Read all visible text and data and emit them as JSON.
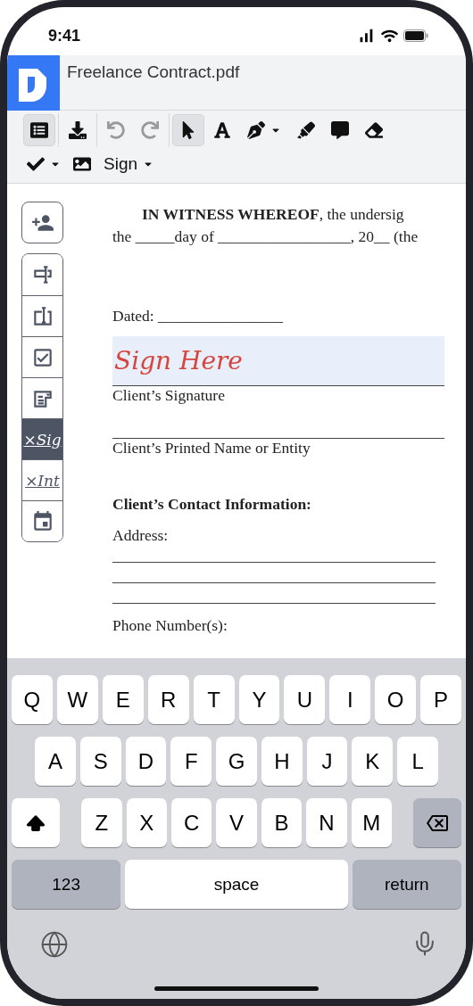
{
  "status_bar": {
    "time": "9:41"
  },
  "header": {
    "title": "Freelance Contract.pdf"
  },
  "toolbar": {
    "row_1": [
      [
        {
          "selected": true,
          "disabled": false,
          "has_menu": false
        }
      ],
      [
        {
          "selected": false,
          "disabled": false,
          "has_menu": false
        }
      ],
      [
        {
          "selected": false,
          "disabled": true,
          "has_menu": false
        },
        {
          "selected": false,
          "disabled": true,
          "has_menu": false
        }
      ],
      [
        {
          "selected": true,
          "disabled": false,
          "has_menu": false
        },
        {
          "selected": false,
          "disabled": false,
          "has_menu": false
        },
        {
          "selected": false,
          "disabled": false,
          "has_menu": true
        },
        {
          "selected": false,
          "disabled": false,
          "has_menu": false
        },
        {
          "selected": false,
          "disabled": false,
          "has_menu": false
        },
        {
          "selected": false,
          "disabled": false,
          "has_menu": false
        }
      ]
    ],
    "row_2": [
      {
        "selected": false,
        "has_menu": true
      },
      {
        "selected": false,
        "has_menu": false
      },
      {
        "selected": false,
        "has_menu": true,
        "label": "Sign"
      }
    ]
  },
  "sidebar": {
    "tools": [
      {
        "selected": false
      },
      {
        "selected": false
      },
      {
        "selected": false
      },
      {
        "selected": false
      },
      {
        "selected": true,
        "label": "×Sig"
      },
      {
        "selected": false,
        "label": "×Int"
      },
      {
        "selected": false
      }
    ]
  },
  "document": [
    {
      "kind": "paragraph",
      "lines": [
        "**IN WITNESS WHEREOF**, the undersig",
        "the _____day of _________________, 20__ (the"
      ]
    },
    {
      "kind": "text",
      "text": "Dated: ________________"
    },
    {
      "kind": "signature",
      "placeholder": "Sign Here",
      "label": "Client’s Signature"
    },
    {
      "kind": "line",
      "label": "Client’s Printed Name or Entity"
    },
    {
      "kind": "heading",
      "text": "Client’s Contact Information:"
    },
    {
      "kind": "lines",
      "label": "Address:"
    },
    {
      "kind": "text",
      "text": "Phone Number(s):"
    }
  ],
  "keyboard": {
    "rows": [
      [
        "Q",
        "W",
        "E",
        "R",
        "T",
        "Y",
        "U",
        "I",
        "O",
        "P"
      ],
      [
        "A",
        "S",
        "D",
        "F",
        "G",
        "H",
        "J",
        "K",
        "L"
      ],
      [
        "Z",
        "X",
        "C",
        "V",
        "B",
        "N",
        "M"
      ]
    ],
    "bottom": [
      {
        "kind": "mode",
        "label": "123"
      },
      {
        "kind": "space",
        "label": "space"
      },
      {
        "kind": "action",
        "label": "return"
      }
    ]
  }
}
